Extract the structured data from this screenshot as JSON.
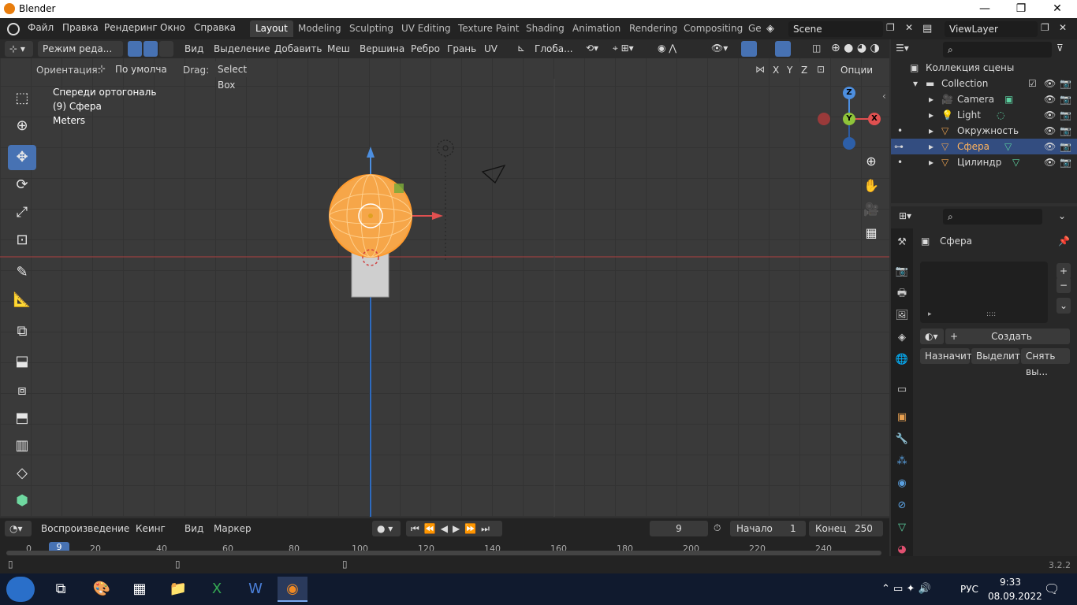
{
  "window": {
    "title": "Blender",
    "min": "—",
    "max": "❐",
    "close": "✕"
  },
  "menu": [
    "Файл",
    "Правка",
    "Рендеринг",
    "Окно",
    "Справка"
  ],
  "workspaces": [
    "Layout",
    "Modeling",
    "Sculpting",
    "UV Editing",
    "Texture Paint",
    "Shading",
    "Animation",
    "Rendering",
    "Compositing",
    "Ge"
  ],
  "scene": "Scene",
  "view_layer": "ViewLayer",
  "header": {
    "mode": "Режим реда...",
    "menus": [
      "Вид",
      "Выделение",
      "Добавить",
      "Меш",
      "Вершина",
      "Ребро",
      "Грань",
      "UV"
    ],
    "transform_orientation": "Глоба...",
    "orientation_label": "Ориентация:",
    "orientation_value": "По умолча",
    "drag_label": "Drag:",
    "drag_value": "Select Box",
    "axes": [
      "X",
      "Y",
      "Z"
    ],
    "options": "Опции"
  },
  "viewport": {
    "view_name": "Спереди ортогональ",
    "object_info": "(9) Сфера",
    "units": "Meters",
    "gizmo": {
      "z": "Z",
      "y": "Y",
      "x": "X"
    }
  },
  "outliner": {
    "title": "Коллекция сцены",
    "collection": "Collection",
    "items": [
      "Camera",
      "Light",
      "Окружность",
      "Сфера",
      "Цилиндр"
    ]
  },
  "properties": {
    "object_name": "Сфера",
    "create": "Создать",
    "assign": "Назначить",
    "select": "Выделить",
    "deselect": "Снять вы..."
  },
  "timeline": {
    "playback": "Воспроизведение",
    "keying": "Кеинг",
    "view": "Вид",
    "marker": "Маркер",
    "current_frame": "9",
    "start_label": "Начало",
    "start": "1",
    "end_label": "Конец",
    "end": "250",
    "ticks": [
      "0",
      "20",
      "40",
      "60",
      "80",
      "100",
      "120",
      "140",
      "160",
      "180",
      "200",
      "220",
      "240"
    ],
    "playhead": "9"
  },
  "status": {
    "version": "3.2.2"
  },
  "taskbar": {
    "lang": "РУС",
    "time": "9:33",
    "date": "08.09.2022"
  }
}
